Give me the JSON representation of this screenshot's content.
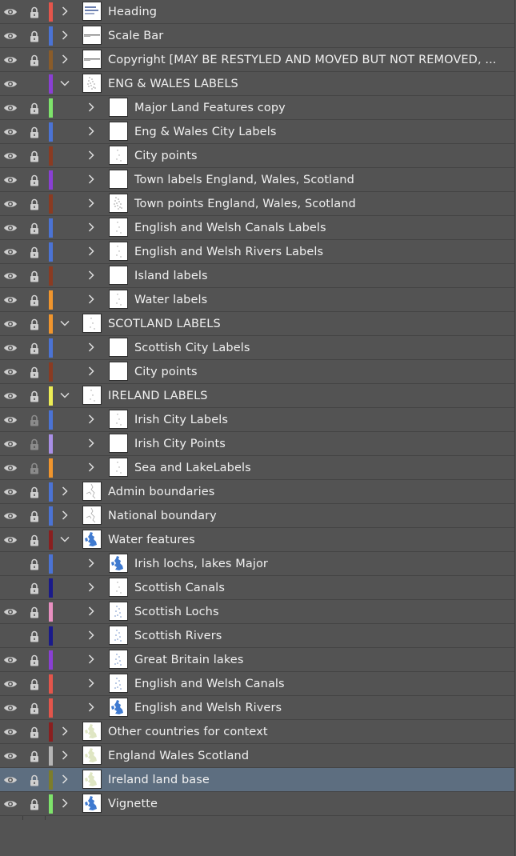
{
  "layers_panel": {
    "layers": [
      {
        "name": "Heading",
        "color": "#e3554b",
        "depth": 0,
        "expanded": false,
        "visible": true,
        "locked": true,
        "selected": false,
        "thumb": "heading"
      },
      {
        "name": "Scale Bar",
        "color": "#4b73d4",
        "depth": 0,
        "expanded": false,
        "visible": true,
        "locked": true,
        "selected": false,
        "thumb": "line"
      },
      {
        "name": "Copyright [MAY BE RESTYLED AND MOVED BUT NOT REMOVED, ...",
        "color": "#8a5c2a",
        "depth": 0,
        "expanded": false,
        "visible": true,
        "locked": true,
        "selected": false,
        "thumb": "line"
      },
      {
        "name": "ENG & WALES LABELS",
        "color": "#8a3fd4",
        "depth": 0,
        "expanded": true,
        "visible": true,
        "locked": false,
        "selected": false,
        "thumb": "dots-map"
      },
      {
        "name": "Major Land Features copy",
        "color": "#7ee36b",
        "depth": 1,
        "expanded": false,
        "visible": true,
        "locked": true,
        "selected": false,
        "thumb": "blank"
      },
      {
        "name": "Eng & Wales City Labels",
        "color": "#4b73d4",
        "depth": 1,
        "expanded": false,
        "visible": true,
        "locked": true,
        "selected": false,
        "thumb": "blank"
      },
      {
        "name": "City points",
        "color": "#8a3b22",
        "depth": 1,
        "expanded": false,
        "visible": true,
        "locked": true,
        "selected": false,
        "thumb": "sparse"
      },
      {
        "name": "Town labels England, Wales, Scotland",
        "color": "#8a3fd4",
        "depth": 1,
        "expanded": false,
        "visible": true,
        "locked": true,
        "selected": false,
        "thumb": "blank"
      },
      {
        "name": "Town points England, Wales, Scotland",
        "color": "#8a3b22",
        "depth": 1,
        "expanded": false,
        "visible": true,
        "locked": true,
        "selected": false,
        "thumb": "dots-map"
      },
      {
        "name": "English and Welsh Canals Labels",
        "color": "#4b73d4",
        "depth": 1,
        "expanded": false,
        "visible": true,
        "locked": true,
        "selected": false,
        "thumb": "sparse"
      },
      {
        "name": "English and Welsh Rivers Labels",
        "color": "#4b73d4",
        "depth": 1,
        "expanded": false,
        "visible": true,
        "locked": true,
        "selected": false,
        "thumb": "sparse"
      },
      {
        "name": "Island labels",
        "color": "#8a3b22",
        "depth": 1,
        "expanded": false,
        "visible": true,
        "locked": true,
        "selected": false,
        "thumb": "blank"
      },
      {
        "name": "Water labels",
        "color": "#f0952d",
        "depth": 1,
        "expanded": false,
        "visible": true,
        "locked": true,
        "selected": false,
        "thumb": "sparse"
      },
      {
        "name": "SCOTLAND LABELS",
        "color": "#f0952d",
        "depth": 0,
        "expanded": true,
        "visible": true,
        "locked": true,
        "selected": false,
        "thumb": "sparse"
      },
      {
        "name": "Scottish City Labels",
        "color": "#4b73d4",
        "depth": 1,
        "expanded": false,
        "visible": true,
        "locked": true,
        "selected": false,
        "thumb": "blank"
      },
      {
        "name": "City points",
        "color": "#8a3b22",
        "depth": 1,
        "expanded": false,
        "visible": true,
        "locked": true,
        "selected": false,
        "thumb": "blank"
      },
      {
        "name": "IRELAND LABELS",
        "color": "#eded55",
        "depth": 0,
        "expanded": true,
        "visible": true,
        "locked": true,
        "selected": false,
        "thumb": "sparse"
      },
      {
        "name": "Irish City Labels",
        "color": "#4b73d4",
        "depth": 1,
        "expanded": false,
        "visible": true,
        "locked": true,
        "lock_dim": true,
        "selected": false,
        "thumb": "sparse"
      },
      {
        "name": "Irish City Points",
        "color": "#a98fe6",
        "depth": 1,
        "expanded": false,
        "visible": true,
        "locked": true,
        "lock_dim": true,
        "selected": false,
        "thumb": "blank"
      },
      {
        "name": "Sea and LakeLabels",
        "color": "#f0952d",
        "depth": 1,
        "expanded": false,
        "visible": true,
        "locked": true,
        "lock_dim": true,
        "selected": false,
        "thumb": "sparse"
      },
      {
        "name": "Admin boundaries",
        "color": "#4b73d4",
        "depth": 0,
        "expanded": false,
        "visible": true,
        "locked": true,
        "selected": false,
        "thumb": "outline"
      },
      {
        "name": "National boundary",
        "color": "#4b73d4",
        "depth": 0,
        "expanded": false,
        "visible": true,
        "locked": true,
        "selected": false,
        "thumb": "outline"
      },
      {
        "name": "Water features",
        "color": "#8a1f1f",
        "depth": 0,
        "expanded": true,
        "visible": true,
        "locked": true,
        "selected": false,
        "thumb": "blue-map"
      },
      {
        "name": "Irish lochs, lakes Major",
        "color": "#4b73d4",
        "depth": 1,
        "expanded": false,
        "visible": false,
        "locked": true,
        "selected": false,
        "thumb": "blue-map"
      },
      {
        "name": "Scottish Canals",
        "color": "#1a1a8a",
        "depth": 1,
        "expanded": false,
        "visible": false,
        "locked": true,
        "selected": false,
        "thumb": "sparse"
      },
      {
        "name": "Scottish Lochs",
        "color": "#e88fc0",
        "depth": 1,
        "expanded": false,
        "visible": true,
        "locked": true,
        "selected": false,
        "thumb": "sparse-blue"
      },
      {
        "name": "Scottish Rivers",
        "color": "#1a1a8a",
        "depth": 1,
        "expanded": false,
        "visible": false,
        "locked": true,
        "selected": false,
        "thumb": "sparse-blue"
      },
      {
        "name": "Great Britain lakes",
        "color": "#8a3fd4",
        "depth": 1,
        "expanded": false,
        "visible": true,
        "locked": true,
        "selected": false,
        "thumb": "sparse-blue"
      },
      {
        "name": "English and Welsh Canals",
        "color": "#e3554b",
        "depth": 1,
        "expanded": false,
        "visible": true,
        "locked": true,
        "selected": false,
        "thumb": "sparse-blue"
      },
      {
        "name": "English and Welsh Rivers",
        "color": "#e3554b",
        "depth": 1,
        "expanded": false,
        "visible": true,
        "locked": true,
        "selected": false,
        "thumb": "blue-map"
      },
      {
        "name": "Other countries for context",
        "color": "#8a1f1f",
        "depth": 0,
        "expanded": false,
        "visible": true,
        "locked": true,
        "selected": false,
        "thumb": "green-map"
      },
      {
        "name": "England Wales Scotland",
        "color": "#b5b5b5",
        "depth": 0,
        "expanded": false,
        "visible": true,
        "locked": true,
        "selected": false,
        "thumb": "green-map"
      },
      {
        "name": "Ireland land base",
        "color": "#7d7d2a",
        "depth": 0,
        "expanded": false,
        "visible": true,
        "locked": true,
        "selected": true,
        "thumb": "green-map"
      },
      {
        "name": "Vignette",
        "color": "#7ee36b",
        "depth": 0,
        "expanded": false,
        "visible": true,
        "locked": true,
        "selected": false,
        "thumb": "blue-map"
      }
    ]
  }
}
